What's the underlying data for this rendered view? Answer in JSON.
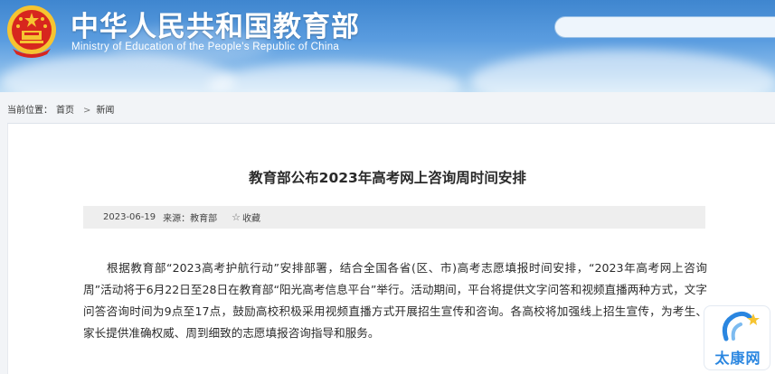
{
  "header": {
    "title": "中华人民共和国教育部",
    "subtitle": "Ministry of Education of the People's Republic of China",
    "search_placeholder": ""
  },
  "breadcrumb": {
    "prefix": "当前位置：",
    "items": [
      "首页",
      "新闻"
    ],
    "separator": ">"
  },
  "article": {
    "title": "教育部公布2023年高考网上咨询周时间安排",
    "date": "2023-06-19",
    "source": "来源：教育部",
    "favorite_label": "收藏",
    "body": "根据教育部“2023高考护航行动”安排部署，结合全国各省(区、市)高考志愿填报时间安排，“2023年高考网上咨询周”活动将于6月22日至28日在教育部“阳光高考信息平台”举行。活动期间，平台将提供文字问答和视频直播两种方式，文字问答咨询时间为9点至17点，鼓励高校积极采用视频直播方式开展招生宣传和咨询。各高校将加强线上招生宣传，为考生、家长提供准确权威、周到细致的志愿填报咨询指导和服务。"
  },
  "watermark": {
    "text": "太康网"
  },
  "colors": {
    "header_top": "#3f86cf",
    "header_bottom": "#bcdcf4",
    "emblem_red": "#d7261e",
    "emblem_gold": "#f6c431",
    "watermark_blue": "#2a86e0"
  },
  "icons": {
    "emblem": "national-emblem-icon",
    "favorite": "star-outline-icon"
  }
}
